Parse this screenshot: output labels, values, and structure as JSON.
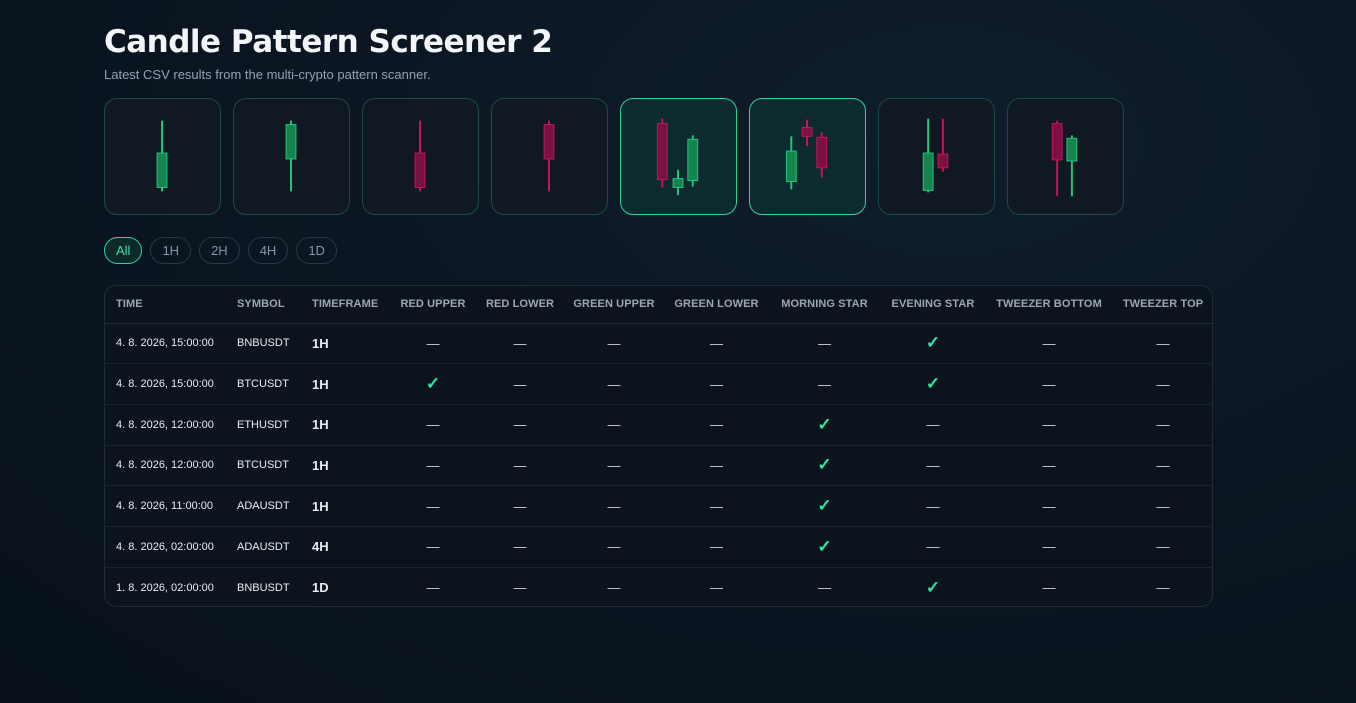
{
  "header": {
    "title": "Candle Pattern Screener 2",
    "subtitle": "Latest CSV results from the multi-crypto pattern scanner."
  },
  "pattern_cards": [
    {
      "icon": "green-hammer-candle-icon",
      "active": false
    },
    {
      "icon": "green-inverted-hammer-candle-icon",
      "active": false
    },
    {
      "icon": "red-hammer-candle-icon",
      "active": false
    },
    {
      "icon": "red-inverted-hammer-candle-icon",
      "active": false
    },
    {
      "icon": "morning-star-pattern-icon",
      "active": true
    },
    {
      "icon": "evening-star-pattern-icon",
      "active": true
    },
    {
      "icon": "tweezer-bottom-pattern-icon",
      "active": false
    },
    {
      "icon": "tweezer-top-pattern-icon",
      "active": false
    }
  ],
  "filters": {
    "options": [
      "All",
      "1H",
      "2H",
      "4H",
      "1D"
    ],
    "selected": "All"
  },
  "table": {
    "columns": [
      "TIME",
      "SYMBOL",
      "TIMEFRAME",
      "RED UPPER",
      "RED LOWER",
      "GREEN UPPER",
      "GREEN LOWER",
      "MORNING STAR",
      "EVENING STAR",
      "TWEEZER BOTTOM",
      "TWEEZER TOP"
    ],
    "rows": [
      {
        "time": "4. 8. 2026, 15:00:00",
        "symbol": "BNBUSDT",
        "timeframe": "1H",
        "cells": [
          "—",
          "—",
          "—",
          "—",
          "—",
          "✓",
          "—",
          "—"
        ]
      },
      {
        "time": "4. 8. 2026, 15:00:00",
        "symbol": "BTCUSDT",
        "timeframe": "1H",
        "cells": [
          "✓",
          "—",
          "—",
          "—",
          "—",
          "✓",
          "—",
          "—"
        ]
      },
      {
        "time": "4. 8. 2026, 12:00:00",
        "symbol": "ETHUSDT",
        "timeframe": "1H",
        "cells": [
          "—",
          "—",
          "—",
          "—",
          "✓",
          "—",
          "—",
          "—"
        ]
      },
      {
        "time": "4. 8. 2026, 12:00:00",
        "symbol": "BTCUSDT",
        "timeframe": "1H",
        "cells": [
          "—",
          "—",
          "—",
          "—",
          "✓",
          "—",
          "—",
          "—"
        ]
      },
      {
        "time": "4. 8. 2026, 11:00:00",
        "symbol": "ADAUSDT",
        "timeframe": "1H",
        "cells": [
          "—",
          "—",
          "—",
          "—",
          "✓",
          "—",
          "—",
          "—"
        ]
      },
      {
        "time": "4. 8. 2026, 02:00:00",
        "symbol": "ADAUSDT",
        "timeframe": "4H",
        "cells": [
          "—",
          "—",
          "—",
          "—",
          "✓",
          "—",
          "—",
          "—"
        ]
      },
      {
        "time": "1. 8. 2026, 02:00:00",
        "symbol": "BNBUSDT",
        "timeframe": "1D",
        "cells": [
          "—",
          "—",
          "—",
          "—",
          "—",
          "✓",
          "—",
          "—"
        ]
      }
    ]
  },
  "colors": {
    "accent": "#2bd49a",
    "bull": "#1fc77d",
    "bear": "#c8125a",
    "check": "#2ee59b"
  }
}
